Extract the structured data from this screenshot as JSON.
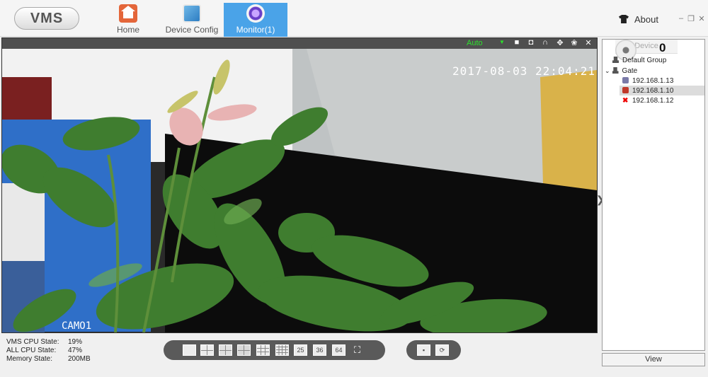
{
  "app": {
    "logo": "VMS"
  },
  "nav": {
    "home": "Home",
    "device_config": "Device Config",
    "monitor": "Monitor(1)"
  },
  "window": {
    "about": "About",
    "minimize": "–",
    "restore": "❐",
    "close": "✕"
  },
  "video": {
    "mode": "Auto",
    "osd_time": "2017-08-03  22:04:21",
    "osd_camera": "CAMO1",
    "tools": [
      "record-icon",
      "snapshot-icon",
      "talk-icon",
      "ptz-icon",
      "color-adjust-icon",
      "close-icon"
    ]
  },
  "device_panel": {
    "header": "Device",
    "count": "0",
    "tree": {
      "default_group": "Default Group",
      "gate_group": "Gate",
      "devices": [
        "192.168.1.13",
        "192.168.1.10",
        "192.168.1.12"
      ]
    },
    "view_button": "View"
  },
  "status": {
    "vms_cpu_label": "VMS CPU State:",
    "vms_cpu_value": "19%",
    "all_cpu_label": "ALL CPU State:",
    "all_cpu_value": "47%",
    "memory_label": "Memory State:",
    "memory_value": "200MB"
  },
  "layout_bar": {
    "split_25": "25",
    "split_36": "36",
    "split_64": "64"
  },
  "colors": {
    "accent": "#4aa3e8",
    "mode_green": "#2ee02e",
    "toolbar_dark": "#5a5a5a"
  }
}
